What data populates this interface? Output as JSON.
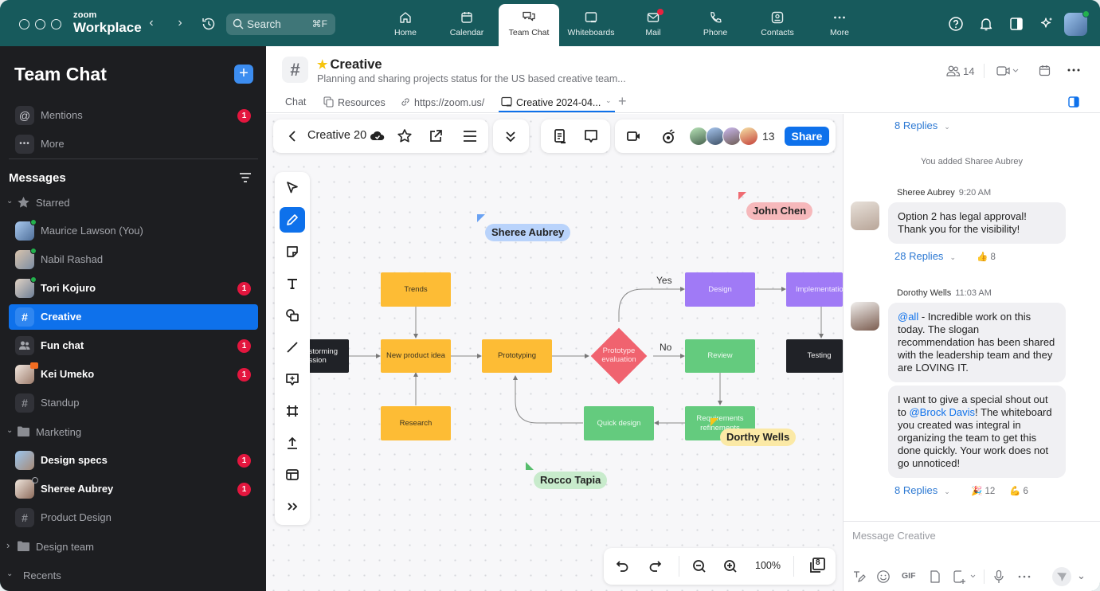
{
  "app": {
    "brand_top": "zoom",
    "brand_bottom": "Workplace",
    "search": {
      "label": "Search",
      "shortcut": "⌘F"
    },
    "tabs": [
      {
        "label": "Home",
        "icon": "home-icon"
      },
      {
        "label": "Calendar",
        "icon": "calendar-icon"
      },
      {
        "label": "Team Chat",
        "icon": "chat-icon",
        "active": true
      },
      {
        "label": "Whiteboards",
        "icon": "whiteboard-icon"
      },
      {
        "label": "Mail",
        "icon": "mail-icon",
        "notification_dot": true
      },
      {
        "label": "Phone",
        "icon": "phone-icon"
      },
      {
        "label": "Contacts",
        "icon": "contacts-icon"
      },
      {
        "label": "More",
        "icon": "more-icon"
      }
    ],
    "right_icons": [
      "help-icon",
      "bell-icon",
      "side-panel-icon",
      "ai-sparkle-icon"
    ]
  },
  "sidebar": {
    "title": "Team Chat",
    "quick": [
      {
        "label": "Mentions",
        "icon": "@",
        "badge": "1"
      },
      {
        "label": "More",
        "icon": "•••"
      }
    ],
    "messages_label": "Messages",
    "starred_label": "Starred",
    "starred": [
      {
        "label": "Maurice Lawson (You)",
        "type": "person",
        "online": true,
        "bold": false
      },
      {
        "label": "Nabil Rashad",
        "type": "person",
        "online": true,
        "bold": false
      },
      {
        "label": "Tori Kojuro",
        "type": "person",
        "online": true,
        "bold": true,
        "badge": "1"
      },
      {
        "label": "Creative",
        "type": "channel",
        "active": true,
        "bold": true
      },
      {
        "label": "Fun chat",
        "type": "group",
        "bold": true,
        "badge": "1"
      },
      {
        "label": "Kei Umeko",
        "type": "person",
        "in_meeting": true,
        "bold": true,
        "badge": "1"
      },
      {
        "label": "Standup",
        "type": "channel",
        "bold": false
      }
    ],
    "marketing_label": "Marketing",
    "marketing": [
      {
        "label": "Design specs",
        "type": "person",
        "bold": true,
        "badge": "1"
      },
      {
        "label": "Sheree Aubrey",
        "type": "person",
        "away": true,
        "bold": true,
        "badge": "1"
      },
      {
        "label": "Product Design",
        "type": "channel",
        "bold": false
      }
    ],
    "design_team_label": "Design team",
    "recents_label": "Recents"
  },
  "channel": {
    "name": "Creative",
    "starred": true,
    "description": "Planning and sharing projects status for the US based creative team...",
    "member_count": "14",
    "tabs": [
      {
        "label": "Chat"
      },
      {
        "label": "Resources",
        "icon": "resources-icon"
      },
      {
        "label": "https://zoom.us/",
        "icon": "link-icon"
      },
      {
        "label": "Creative 2024-04...",
        "icon": "whiteboard-icon",
        "active": true
      }
    ]
  },
  "whiteboard": {
    "name": "Creative 20",
    "collaborator_count": "13",
    "share_label": "Share",
    "zoom_level": "100%",
    "pages_count": "8",
    "tools": [
      "select-icon",
      "pen-icon",
      "sticky-note-icon",
      "text-icon",
      "shapes-icon",
      "line-icon",
      "comment-icon",
      "frame-icon",
      "upload-icon",
      "template-icon",
      "more-tools-icon"
    ],
    "active_tool": "pen-icon",
    "nodes": [
      {
        "id": "brainstorm",
        "label": "Brainstorming session",
        "visible_label": "storming\nssion",
        "color": "dark"
      },
      {
        "id": "trends",
        "label": "Trends",
        "color": "yellow"
      },
      {
        "id": "idea",
        "label": "New product idea",
        "color": "yellow"
      },
      {
        "id": "research",
        "label": "Research",
        "color": "yellow"
      },
      {
        "id": "proto",
        "label": "Prototyping",
        "color": "yellow"
      },
      {
        "id": "eval",
        "label": "Prototype evaluation",
        "color": "red"
      },
      {
        "id": "design",
        "label": "Design",
        "color": "purple"
      },
      {
        "id": "impl",
        "label": "Implementation",
        "color": "purple"
      },
      {
        "id": "review",
        "label": "Review",
        "color": "green"
      },
      {
        "id": "testing",
        "label": "Testing",
        "color": "dark"
      },
      {
        "id": "req",
        "label": "Requirements refinements",
        "color": "green"
      },
      {
        "id": "quick",
        "label": "Quick design",
        "color": "green"
      }
    ],
    "edge_labels": {
      "yes": "Yes",
      "no": "No"
    },
    "cursors": [
      {
        "name": "Sheree Aubrey",
        "color": "#b9d3fb",
        "pointer": "#6aa2f3"
      },
      {
        "name": "John Chen",
        "color": "#f6b8bb",
        "pointer": "#ef6c73"
      },
      {
        "name": "Dorthy Wells",
        "color": "#fbe9a6",
        "pointer": "#f7c51a"
      },
      {
        "name": "Rocco Tapia",
        "color": "#c8ebcc",
        "pointer": "#56bd6c"
      }
    ]
  },
  "chat": {
    "top_replies": "8 Replies",
    "system": "You added Sharee Aubrey",
    "messages": [
      {
        "sender": "Sheree Aubrey",
        "time": "9:20 AM",
        "text": "Option 2 has legal approval! Thank you for the visibility!",
        "replies": "28 Replies",
        "reactions": [
          {
            "emoji": "👍",
            "count": "8"
          }
        ]
      },
      {
        "sender": "Dorothy Wells",
        "time": "11:03 AM",
        "mention": "@all",
        "text": " - Incredible work on this today. The slogan recommendation has been shared with the leadership team and they are LOVING IT."
      },
      {
        "text_before": "I want to give a special shout out to ",
        "mention": "@Brock Davis",
        "text_after": "! The whiteboard you created was integral in organizing the team to get this done quickly. Your work does not go unnoticed!",
        "replies": "8 Replies",
        "reactions": [
          {
            "emoji": "🎉",
            "count": "12"
          },
          {
            "emoji": "💪",
            "count": "6"
          }
        ]
      }
    ],
    "composer_placeholder": "Message Creative",
    "composer_tools": [
      "format-icon",
      "emoji-icon",
      "GIF",
      "file-icon",
      "screenshot-icon",
      "mic-icon",
      "more-icon"
    ]
  }
}
